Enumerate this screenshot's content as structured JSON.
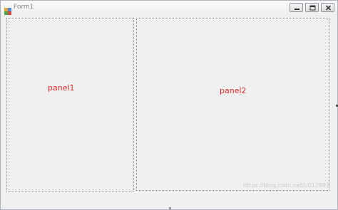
{
  "window": {
    "title": "Form1"
  },
  "panels": [
    {
      "label": "panel1"
    },
    {
      "label": "panel2"
    }
  ],
  "colors": {
    "panel_label": "#e02a2a",
    "background": "#f0f0f0",
    "panel_border": "#8c8c8c"
  },
  "watermark": "https://blog.csdn.net/u012993"
}
